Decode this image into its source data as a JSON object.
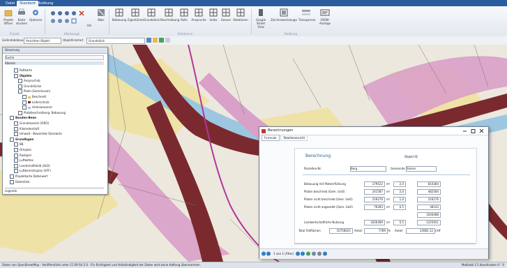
{
  "ribbon": {
    "tabs": [
      "Datei",
      "Standard",
      "Bodbung"
    ],
    "buttons": [
      "Projekt öffnen",
      "Karte drucken",
      "Optionen",
      "Um",
      "Abbr.",
      "Bebauung",
      "Eigentümer",
      "Grundstück",
      "Beschreibung",
      "Rolle",
      "Anspruche",
      "Index",
      "Geovor",
      "Relationen",
      "Google Street View",
      "Zeichenwerkzeuge",
      "Transparenz",
      "OSSM-Anzeige"
    ],
    "groups": [
      "Projekt",
      "Werkzeuge",
      "Relationen",
      "Bodbung"
    ]
  },
  "addressbar": {
    "label_left": "Geländebebauung",
    "combo_left": "Ansichten Objekt",
    "label_right": "Objektlinkstart",
    "combo_right": "Grundstück"
  },
  "panel": {
    "title": "Steuerung",
    "search": "Suche",
    "header": "Ebenen",
    "items": [
      "Roßkarte",
      "Objekte",
      "Anspruchsb.",
      "Grundstücke",
      "Plate (Gemeinsam)",
      "Beschnett",
      "Leiterschutz",
      "Unterwasserel",
      "Platebeschreibung: Bebauung",
      "Bauden-Bene",
      "Grundstueckk (VIRO)",
      "Kilometerkluft",
      "Umwelt - Bewertete Standorte",
      "Grundlagen",
      "BB",
      "Ortsplan",
      "Radspiel",
      "Luftkettes",
      "Landschaftsbild (ALD)",
      "Luftbereichsplan (VFF)",
      "Projektkarte Datenwert",
      "Datenliste"
    ],
    "footer": "Legende"
  },
  "dialog": {
    "title": "Berechnungen",
    "tabs": [
      "Formular",
      "Tabellenansicht"
    ],
    "heading": "Berechnung",
    "objekt_label": "Objekt ID",
    "parzelle_label": "Parzellen-Nr.",
    "parzelle_value": "Berg",
    "gemeinde_label": "Gemeinde",
    "gemeinde_value": "Siezen",
    "rows": [
      {
        "label": "Bebauung mit Plateerfüllnung",
        "v1": "279522",
        "u": "m²",
        "f": "2,0",
        "r": "810384"
      },
      {
        "label": "Platen beschrieb (Gem. GeO)",
        "v1": "241587",
        "u": "m²",
        "f": "2,0",
        "r": "482584"
      },
      {
        "label": "Platen nicht beschrieb (Gem. GeO)",
        "v1": "216276",
        "u": "m²",
        "f": "1,0",
        "r": "216276"
      },
      {
        "label": "Platen nicht angesetzt (Gem. GeO)",
        "v1": "76283",
        "u": "m²",
        "f": "0,5",
        "r": "38142"
      },
      {
        "label": "",
        "v1": "",
        "u": "",
        "f": "",
        "r": "1626488"
      },
      {
        "label": "Landwirtschaftliche Nutzung",
        "v1": "1626489",
        "u": "m²",
        "f": "0,5",
        "r": "1225651"
      }
    ],
    "totals": {
      "label": "Total Teilflächen",
      "a": "10758021",
      "b_label": "Anteil",
      "b": "7789",
      "b_unit": "%",
      "c_label": "Anteil",
      "c": "33982.12",
      "c_unit": "CHF"
    },
    "nav_text": "1 von 1 (Filter)"
  },
  "status": {
    "left": "Daten von OpenStreetMap - Veröffentlicht unter CC-BY-SA 2.0 - Für Richtigkeit und Vollständigkeit der Daten wird keine Haftung übernommen.",
    "right": "Maßstab 1:5 Koordinaten 0 ° 0"
  },
  "colors": {
    "accent": "#2b5c9e",
    "road": "#7a2a2e",
    "water": "#9dc7e0",
    "pink": "#d9a0c8",
    "yellow": "#efe2a6"
  }
}
